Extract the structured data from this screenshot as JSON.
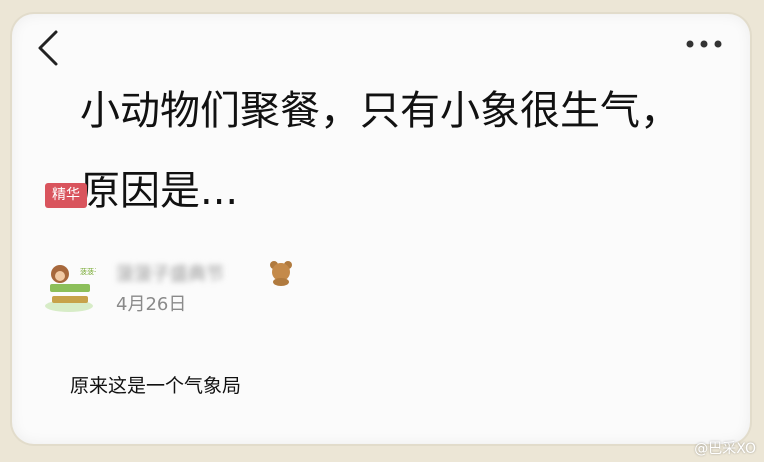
{
  "post": {
    "title": "小动物们聚餐，只有小象很生气，原因是...",
    "tag": "精华",
    "author": {
      "name": "菠菠子盛典节",
      "date": "4月26日",
      "avatar_text": "菠菠子 蛤蟆"
    },
    "body": "原来这是一个气象局"
  },
  "watermark": "@巴采XO",
  "icons": {
    "back": "chevron-left-icon",
    "more": "more-dots-icon",
    "badge": "bear-icon"
  },
  "colors": {
    "tag_bg": "#d9545d",
    "page_bg": "#ece6d6",
    "card_bg": "#fbfbfb"
  }
}
